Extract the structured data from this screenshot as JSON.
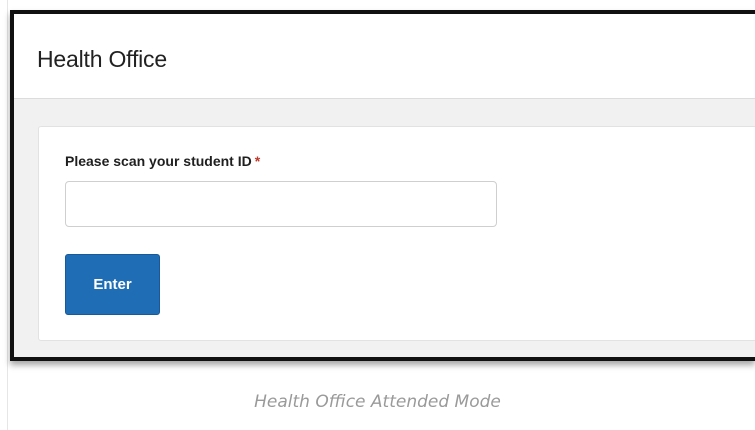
{
  "header": {
    "title": "Health Office"
  },
  "form": {
    "label": "Please scan your student ID",
    "required_marker": "*",
    "input_value": "",
    "input_placeholder": "",
    "enter_label": "Enter"
  },
  "caption": "Health Office Attended Mode",
  "colors": {
    "button_primary": "#1f6eb5",
    "required_marker": "#c0392b",
    "frame_border": "#111111"
  }
}
